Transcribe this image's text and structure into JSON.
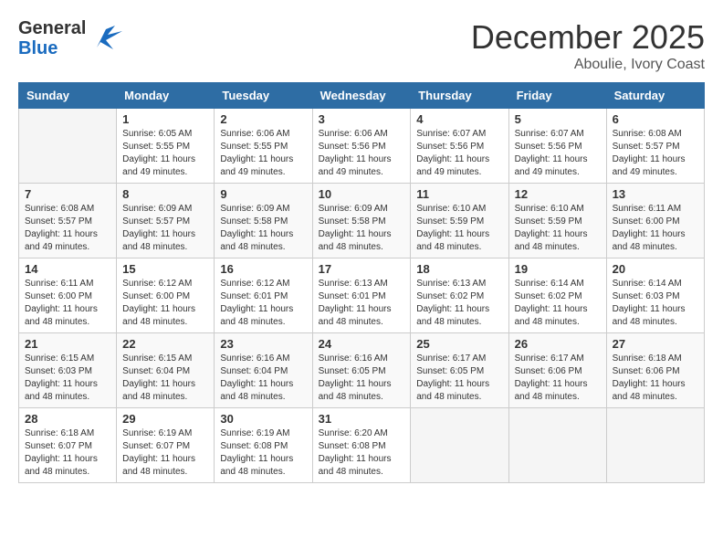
{
  "header": {
    "logo_general": "General",
    "logo_blue": "Blue",
    "month_title": "December 2025",
    "location": "Aboulie, Ivory Coast"
  },
  "days_of_week": [
    "Sunday",
    "Monday",
    "Tuesday",
    "Wednesday",
    "Thursday",
    "Friday",
    "Saturday"
  ],
  "weeks": [
    [
      {
        "day": "",
        "sunrise": "",
        "sunset": "",
        "daylight": ""
      },
      {
        "day": "1",
        "sunrise": "Sunrise: 6:05 AM",
        "sunset": "Sunset: 5:55 PM",
        "daylight": "Daylight: 11 hours and 49 minutes."
      },
      {
        "day": "2",
        "sunrise": "Sunrise: 6:06 AM",
        "sunset": "Sunset: 5:55 PM",
        "daylight": "Daylight: 11 hours and 49 minutes."
      },
      {
        "day": "3",
        "sunrise": "Sunrise: 6:06 AM",
        "sunset": "Sunset: 5:56 PM",
        "daylight": "Daylight: 11 hours and 49 minutes."
      },
      {
        "day": "4",
        "sunrise": "Sunrise: 6:07 AM",
        "sunset": "Sunset: 5:56 PM",
        "daylight": "Daylight: 11 hours and 49 minutes."
      },
      {
        "day": "5",
        "sunrise": "Sunrise: 6:07 AM",
        "sunset": "Sunset: 5:56 PM",
        "daylight": "Daylight: 11 hours and 49 minutes."
      },
      {
        "day": "6",
        "sunrise": "Sunrise: 6:08 AM",
        "sunset": "Sunset: 5:57 PM",
        "daylight": "Daylight: 11 hours and 49 minutes."
      }
    ],
    [
      {
        "day": "7",
        "sunrise": "Sunrise: 6:08 AM",
        "sunset": "Sunset: 5:57 PM",
        "daylight": "Daylight: 11 hours and 49 minutes."
      },
      {
        "day": "8",
        "sunrise": "Sunrise: 6:09 AM",
        "sunset": "Sunset: 5:57 PM",
        "daylight": "Daylight: 11 hours and 48 minutes."
      },
      {
        "day": "9",
        "sunrise": "Sunrise: 6:09 AM",
        "sunset": "Sunset: 5:58 PM",
        "daylight": "Daylight: 11 hours and 48 minutes."
      },
      {
        "day": "10",
        "sunrise": "Sunrise: 6:09 AM",
        "sunset": "Sunset: 5:58 PM",
        "daylight": "Daylight: 11 hours and 48 minutes."
      },
      {
        "day": "11",
        "sunrise": "Sunrise: 6:10 AM",
        "sunset": "Sunset: 5:59 PM",
        "daylight": "Daylight: 11 hours and 48 minutes."
      },
      {
        "day": "12",
        "sunrise": "Sunrise: 6:10 AM",
        "sunset": "Sunset: 5:59 PM",
        "daylight": "Daylight: 11 hours and 48 minutes."
      },
      {
        "day": "13",
        "sunrise": "Sunrise: 6:11 AM",
        "sunset": "Sunset: 6:00 PM",
        "daylight": "Daylight: 11 hours and 48 minutes."
      }
    ],
    [
      {
        "day": "14",
        "sunrise": "Sunrise: 6:11 AM",
        "sunset": "Sunset: 6:00 PM",
        "daylight": "Daylight: 11 hours and 48 minutes."
      },
      {
        "day": "15",
        "sunrise": "Sunrise: 6:12 AM",
        "sunset": "Sunset: 6:00 PM",
        "daylight": "Daylight: 11 hours and 48 minutes."
      },
      {
        "day": "16",
        "sunrise": "Sunrise: 6:12 AM",
        "sunset": "Sunset: 6:01 PM",
        "daylight": "Daylight: 11 hours and 48 minutes."
      },
      {
        "day": "17",
        "sunrise": "Sunrise: 6:13 AM",
        "sunset": "Sunset: 6:01 PM",
        "daylight": "Daylight: 11 hours and 48 minutes."
      },
      {
        "day": "18",
        "sunrise": "Sunrise: 6:13 AM",
        "sunset": "Sunset: 6:02 PM",
        "daylight": "Daylight: 11 hours and 48 minutes."
      },
      {
        "day": "19",
        "sunrise": "Sunrise: 6:14 AM",
        "sunset": "Sunset: 6:02 PM",
        "daylight": "Daylight: 11 hours and 48 minutes."
      },
      {
        "day": "20",
        "sunrise": "Sunrise: 6:14 AM",
        "sunset": "Sunset: 6:03 PM",
        "daylight": "Daylight: 11 hours and 48 minutes."
      }
    ],
    [
      {
        "day": "21",
        "sunrise": "Sunrise: 6:15 AM",
        "sunset": "Sunset: 6:03 PM",
        "daylight": "Daylight: 11 hours and 48 minutes."
      },
      {
        "day": "22",
        "sunrise": "Sunrise: 6:15 AM",
        "sunset": "Sunset: 6:04 PM",
        "daylight": "Daylight: 11 hours and 48 minutes."
      },
      {
        "day": "23",
        "sunrise": "Sunrise: 6:16 AM",
        "sunset": "Sunset: 6:04 PM",
        "daylight": "Daylight: 11 hours and 48 minutes."
      },
      {
        "day": "24",
        "sunrise": "Sunrise: 6:16 AM",
        "sunset": "Sunset: 6:05 PM",
        "daylight": "Daylight: 11 hours and 48 minutes."
      },
      {
        "day": "25",
        "sunrise": "Sunrise: 6:17 AM",
        "sunset": "Sunset: 6:05 PM",
        "daylight": "Daylight: 11 hours and 48 minutes."
      },
      {
        "day": "26",
        "sunrise": "Sunrise: 6:17 AM",
        "sunset": "Sunset: 6:06 PM",
        "daylight": "Daylight: 11 hours and 48 minutes."
      },
      {
        "day": "27",
        "sunrise": "Sunrise: 6:18 AM",
        "sunset": "Sunset: 6:06 PM",
        "daylight": "Daylight: 11 hours and 48 minutes."
      }
    ],
    [
      {
        "day": "28",
        "sunrise": "Sunrise: 6:18 AM",
        "sunset": "Sunset: 6:07 PM",
        "daylight": "Daylight: 11 hours and 48 minutes."
      },
      {
        "day": "29",
        "sunrise": "Sunrise: 6:19 AM",
        "sunset": "Sunset: 6:07 PM",
        "daylight": "Daylight: 11 hours and 48 minutes."
      },
      {
        "day": "30",
        "sunrise": "Sunrise: 6:19 AM",
        "sunset": "Sunset: 6:08 PM",
        "daylight": "Daylight: 11 hours and 48 minutes."
      },
      {
        "day": "31",
        "sunrise": "Sunrise: 6:20 AM",
        "sunset": "Sunset: 6:08 PM",
        "daylight": "Daylight: 11 hours and 48 minutes."
      },
      {
        "day": "",
        "sunrise": "",
        "sunset": "",
        "daylight": ""
      },
      {
        "day": "",
        "sunrise": "",
        "sunset": "",
        "daylight": ""
      },
      {
        "day": "",
        "sunrise": "",
        "sunset": "",
        "daylight": ""
      }
    ]
  ]
}
